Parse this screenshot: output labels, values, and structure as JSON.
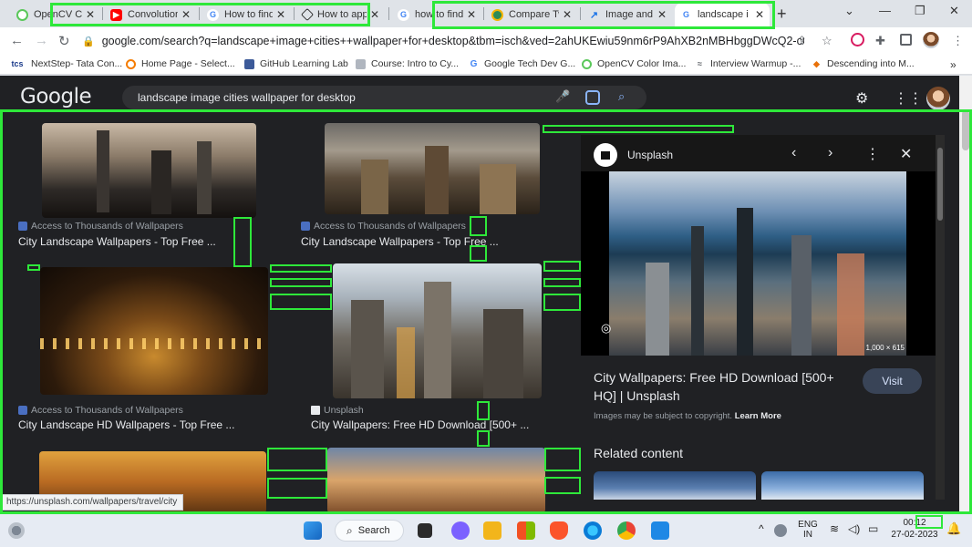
{
  "tabs": [
    {
      "title": "OpenCV Co",
      "favicon": "opencv-favicon"
    },
    {
      "title": "Convolution",
      "favicon": "youtube-favicon"
    },
    {
      "title": "How to find",
      "favicon": "google-favicon"
    },
    {
      "title": "How to app",
      "favicon": "stack-favicon"
    },
    {
      "title": "how to find",
      "favicon": "google-favicon"
    },
    {
      "title": "Compare Tw",
      "favicon": "compare-favicon"
    },
    {
      "title": "Image and",
      "favicon": "chart-favicon"
    },
    {
      "title": "landscape i",
      "favicon": "google-favicon",
      "active": true
    }
  ],
  "toolbar": {
    "url": "google.com/search?q=landscape+image+cities++wallpaper+for+desktop&tbm=isch&ved=2ahUKEwiu59nm6rP9AhXB2nMBHbggDWcQ2-cCe..."
  },
  "bookmarks": [
    {
      "label": "NextStep- Tata Con...",
      "icon": "tcs-icon"
    },
    {
      "label": "Home Page - Select...",
      "icon": "home-icon"
    },
    {
      "label": "GitHub Learning Lab",
      "icon": "github-icon"
    },
    {
      "label": "Course: Intro to Cy...",
      "icon": "course-icon"
    },
    {
      "label": "Google Tech Dev G...",
      "icon": "google-icon"
    },
    {
      "label": "OpenCV Color Ima...",
      "icon": "opencv-icon"
    },
    {
      "label": "Interview Warmup -...",
      "icon": "warmup-icon"
    },
    {
      "label": "Descending into M...",
      "icon": "ml-icon"
    }
  ],
  "google": {
    "logo": "Google",
    "query": "landscape image cities  wallpaper for desktop"
  },
  "results": [
    {
      "source": "Access to Thousands of Wallpapers",
      "title": "City Landscape Wallpapers - Top Free ..."
    },
    {
      "source": "Access to Thousands of Wallpapers",
      "title": "City Landscape Wallpapers - Top Free ..."
    },
    {
      "source": "Access to Thousands of Wallpapers",
      "title": "City Landscape HD Wallpapers - Top Free ..."
    },
    {
      "source": "Unsplash",
      "title": "City Wallpapers: Free HD Download [500+ ..."
    }
  ],
  "preview": {
    "source": "Unsplash",
    "dimensions": "1,000 × 615",
    "title": "City Wallpapers: Free HD Download [500+ HQ] | Unsplash",
    "visit_label": "Visit",
    "copyright": "Images may be subject to copyright.",
    "learn_more": "Learn More",
    "related": "Related content"
  },
  "status_url": "https://unsplash.com/wallpapers/travel/city",
  "taskbar": {
    "search_label": "Search",
    "lang_line1": "ENG",
    "lang_line2": "IN",
    "time": "00:12",
    "date": "27-02-2023"
  },
  "colors": {
    "highlight": "#2ee83a",
    "page_bg": "#202124"
  }
}
